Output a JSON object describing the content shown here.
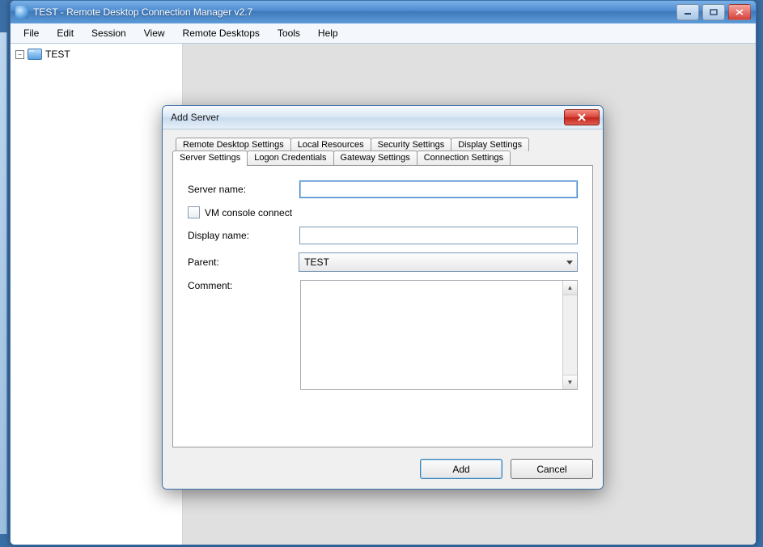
{
  "window": {
    "title": "TEST - Remote Desktop Connection Manager v2.7"
  },
  "menu": {
    "items": [
      "File",
      "Edit",
      "Session",
      "View",
      "Remote Desktops",
      "Tools",
      "Help"
    ]
  },
  "tree": {
    "root_label": "TEST",
    "expander": "–"
  },
  "dialog": {
    "title": "Add Server",
    "tabs_row1": [
      "Remote Desktop Settings",
      "Local Resources",
      "Security Settings",
      "Display Settings"
    ],
    "tabs_row2": [
      "Server Settings",
      "Logon Credentials",
      "Gateway Settings",
      "Connection Settings"
    ],
    "active_tab": "Server Settings",
    "fields": {
      "server_name_label": "Server name:",
      "server_name_value": "",
      "vm_console_label": "VM console connect",
      "vm_console_checked": false,
      "display_name_label": "Display name:",
      "display_name_value": "",
      "parent_label": "Parent:",
      "parent_value": "TEST",
      "comment_label": "Comment:",
      "comment_value": ""
    },
    "buttons": {
      "ok": "Add",
      "cancel": "Cancel"
    }
  }
}
